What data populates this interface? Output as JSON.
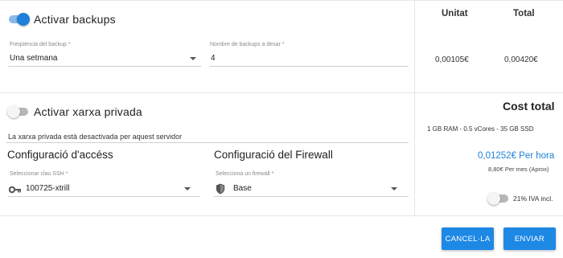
{
  "backups": {
    "toggle_on": true,
    "label": "Activar backups",
    "frequency": {
      "label": "Freqüència del backup *",
      "value": "Una setmana"
    },
    "count": {
      "label": "Nombre de backups a desar *",
      "value": "4"
    }
  },
  "private_network": {
    "toggle_on": false,
    "label": "Activar xarxa privada",
    "note": "La xarxa privada està desactivada per aquest servidor"
  },
  "access": {
    "title": "Configuració d'accéss",
    "ssh": {
      "label": "Seleccionar clau SSH *",
      "value": "100725-xtrill",
      "icon": "key-icon"
    }
  },
  "firewall": {
    "title": "Configuració del Firewall",
    "select": {
      "label": "Selecciona un firewall *",
      "value": "Base",
      "icon": "shield-icon"
    }
  },
  "pricing_table": {
    "headers": [
      "Unitat",
      "Total"
    ],
    "row": [
      "0,00105€",
      "0,00420€"
    ]
  },
  "cost": {
    "title": "Cost total",
    "spec": "1 GB RAM - 0.5 vCores - 35 GB SSD",
    "per_hour": "0,01252€ Per hora",
    "per_month": "8,80€ Per mes (Aprox)",
    "iva": {
      "toggle_on": false,
      "label": "21% IVA incl."
    }
  },
  "actions": {
    "cancel": "CANCEL·LA",
    "submit": "ENVIAR"
  },
  "colors": {
    "accent": "#1e88e5",
    "price_blue": "#1e80d8"
  }
}
